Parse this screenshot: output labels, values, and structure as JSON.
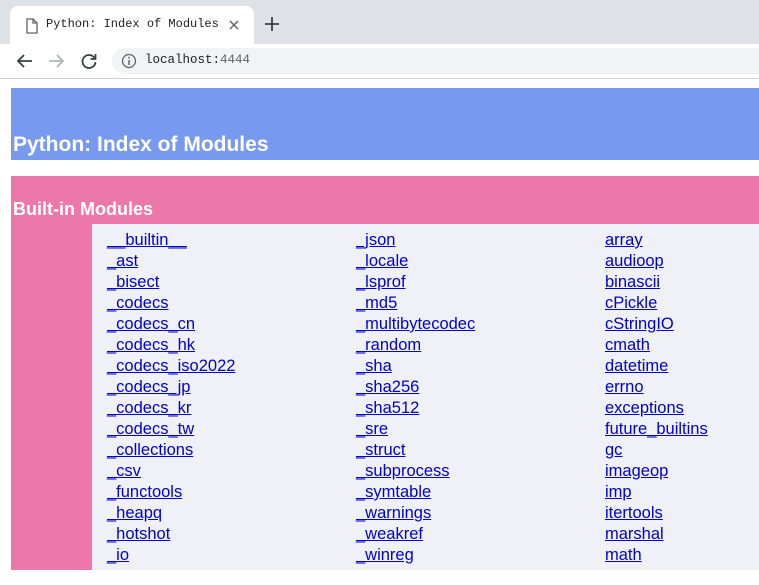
{
  "browser": {
    "tab": {
      "title": "Python: Index of Modules"
    },
    "address": {
      "host": "localhost:",
      "port": "4444"
    }
  },
  "page": {
    "title": "Python: Index of Modules",
    "section": {
      "title": "Built-in Modules",
      "columns": [
        [
          "__builtin__",
          "_ast",
          "_bisect",
          "_codecs",
          "_codecs_cn",
          "_codecs_hk",
          "_codecs_iso2022",
          "_codecs_jp",
          "_codecs_kr",
          "_codecs_tw",
          "_collections",
          "_csv",
          "_functools",
          "_heapq",
          "_hotshot",
          "_io"
        ],
        [
          "_json",
          "_locale",
          "_lsprof",
          "_md5",
          "_multibytecodec",
          "_random",
          "_sha",
          "_sha256",
          "_sha512",
          "_sre",
          "_struct",
          "_subprocess",
          "_symtable",
          "_warnings",
          "_weakref",
          "_winreg"
        ],
        [
          "array",
          "audioop",
          "binascii",
          "cPickle",
          "cStringIO",
          "cmath",
          "datetime",
          "errno",
          "exceptions",
          "future_builtins",
          "gc",
          "imageop",
          "imp",
          "itertools",
          "marshal",
          "math"
        ]
      ]
    }
  }
}
